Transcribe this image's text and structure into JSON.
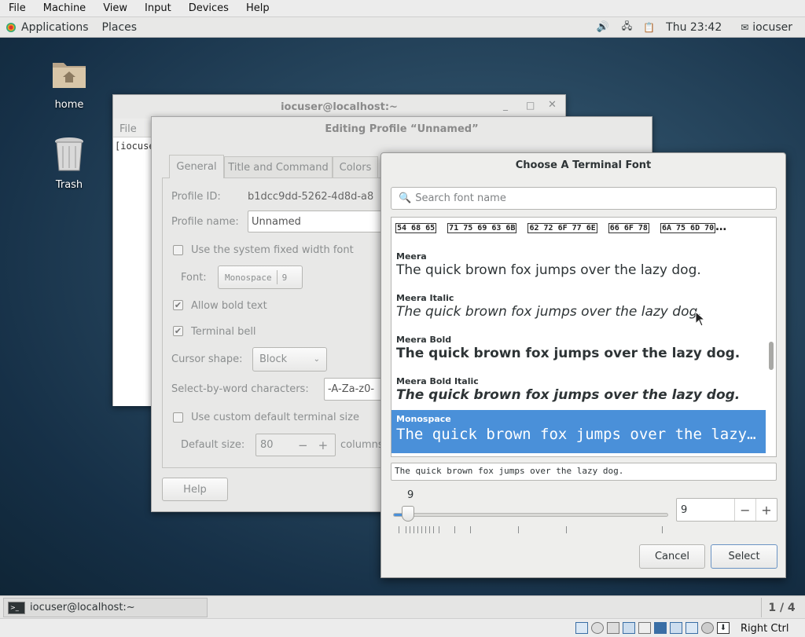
{
  "vbox_menu": {
    "items": [
      "File",
      "Machine",
      "View",
      "Input",
      "Devices",
      "Help"
    ]
  },
  "topbar": {
    "applications": "Applications",
    "places": "Places",
    "clock": "Thu 23:42",
    "user": "iocuser"
  },
  "desktop": {
    "icons": [
      {
        "label": "home",
        "icon": "home-folder-icon"
      },
      {
        "label": "Trash",
        "icon": "trash-icon"
      }
    ]
  },
  "terminal": {
    "title": "iocuser@localhost:~",
    "menu_file": "File",
    "prompt": "[iocuse"
  },
  "profile": {
    "title": "Editing Profile “Unnamed”",
    "tabs": [
      "General",
      "Title and Command",
      "Colors"
    ],
    "profile_id_label": "Profile ID:",
    "profile_id_value": "b1dcc9dd-5262-4d8d-a8",
    "profile_name_label": "Profile name:",
    "profile_name_value": "Unnamed",
    "system_font_label": "Use the system fixed width font",
    "font_label": "Font:",
    "font_value": "Monospace",
    "font_size": "9",
    "bold_label": "Allow bold text",
    "bell_label": "Terminal bell",
    "cursor_label": "Cursor shape:",
    "cursor_value": "Block",
    "word_chars_label": "Select-by-word characters:",
    "word_chars_value": "-A-Za-z0-",
    "custom_size_label": "Use custom default terminal size",
    "default_size_label": "Default size:",
    "default_size_value": "80",
    "columns_label": "columns",
    "help_button": "Help"
  },
  "chooser": {
    "title": "Choose A Terminal Font",
    "search_placeholder": "Search font name",
    "glyph_row": [
      "🀀",
      "🀀",
      "🀀",
      "🀀",
      "🀀"
    ],
    "fonts": [
      {
        "name": "Meera",
        "preview": "The quick brown fox jumps over the lazy dog.",
        "style": "normal"
      },
      {
        "name": "Meera Italic",
        "preview": "The quick brown fox jumps over the lazy dog.",
        "style": "italic"
      },
      {
        "name": "Meera Bold",
        "preview": "The quick brown fox jumps over the lazy dog.",
        "style": "bold"
      },
      {
        "name": "Meera Bold Italic",
        "preview": "The quick brown fox jumps over the lazy dog.",
        "style": "bolditalic"
      },
      {
        "name": "Monospace",
        "preview": "The quick brown fox jumps over the lazy dog.",
        "style": "mono",
        "selected": true
      }
    ],
    "preview_text": "The quick brown fox jumps over the lazy dog.",
    "size_label": "9",
    "size_value": "9",
    "size_fraction": 0.03,
    "cancel": "Cancel",
    "select": "Select"
  },
  "taskbar": {
    "window": "iocuser@localhost:~",
    "workspace": "1 / 4"
  },
  "vbox_status": {
    "host_key": "Right Ctrl"
  },
  "colors": {
    "selection": "#4a90d9",
    "desktop": "#1e3a52"
  }
}
